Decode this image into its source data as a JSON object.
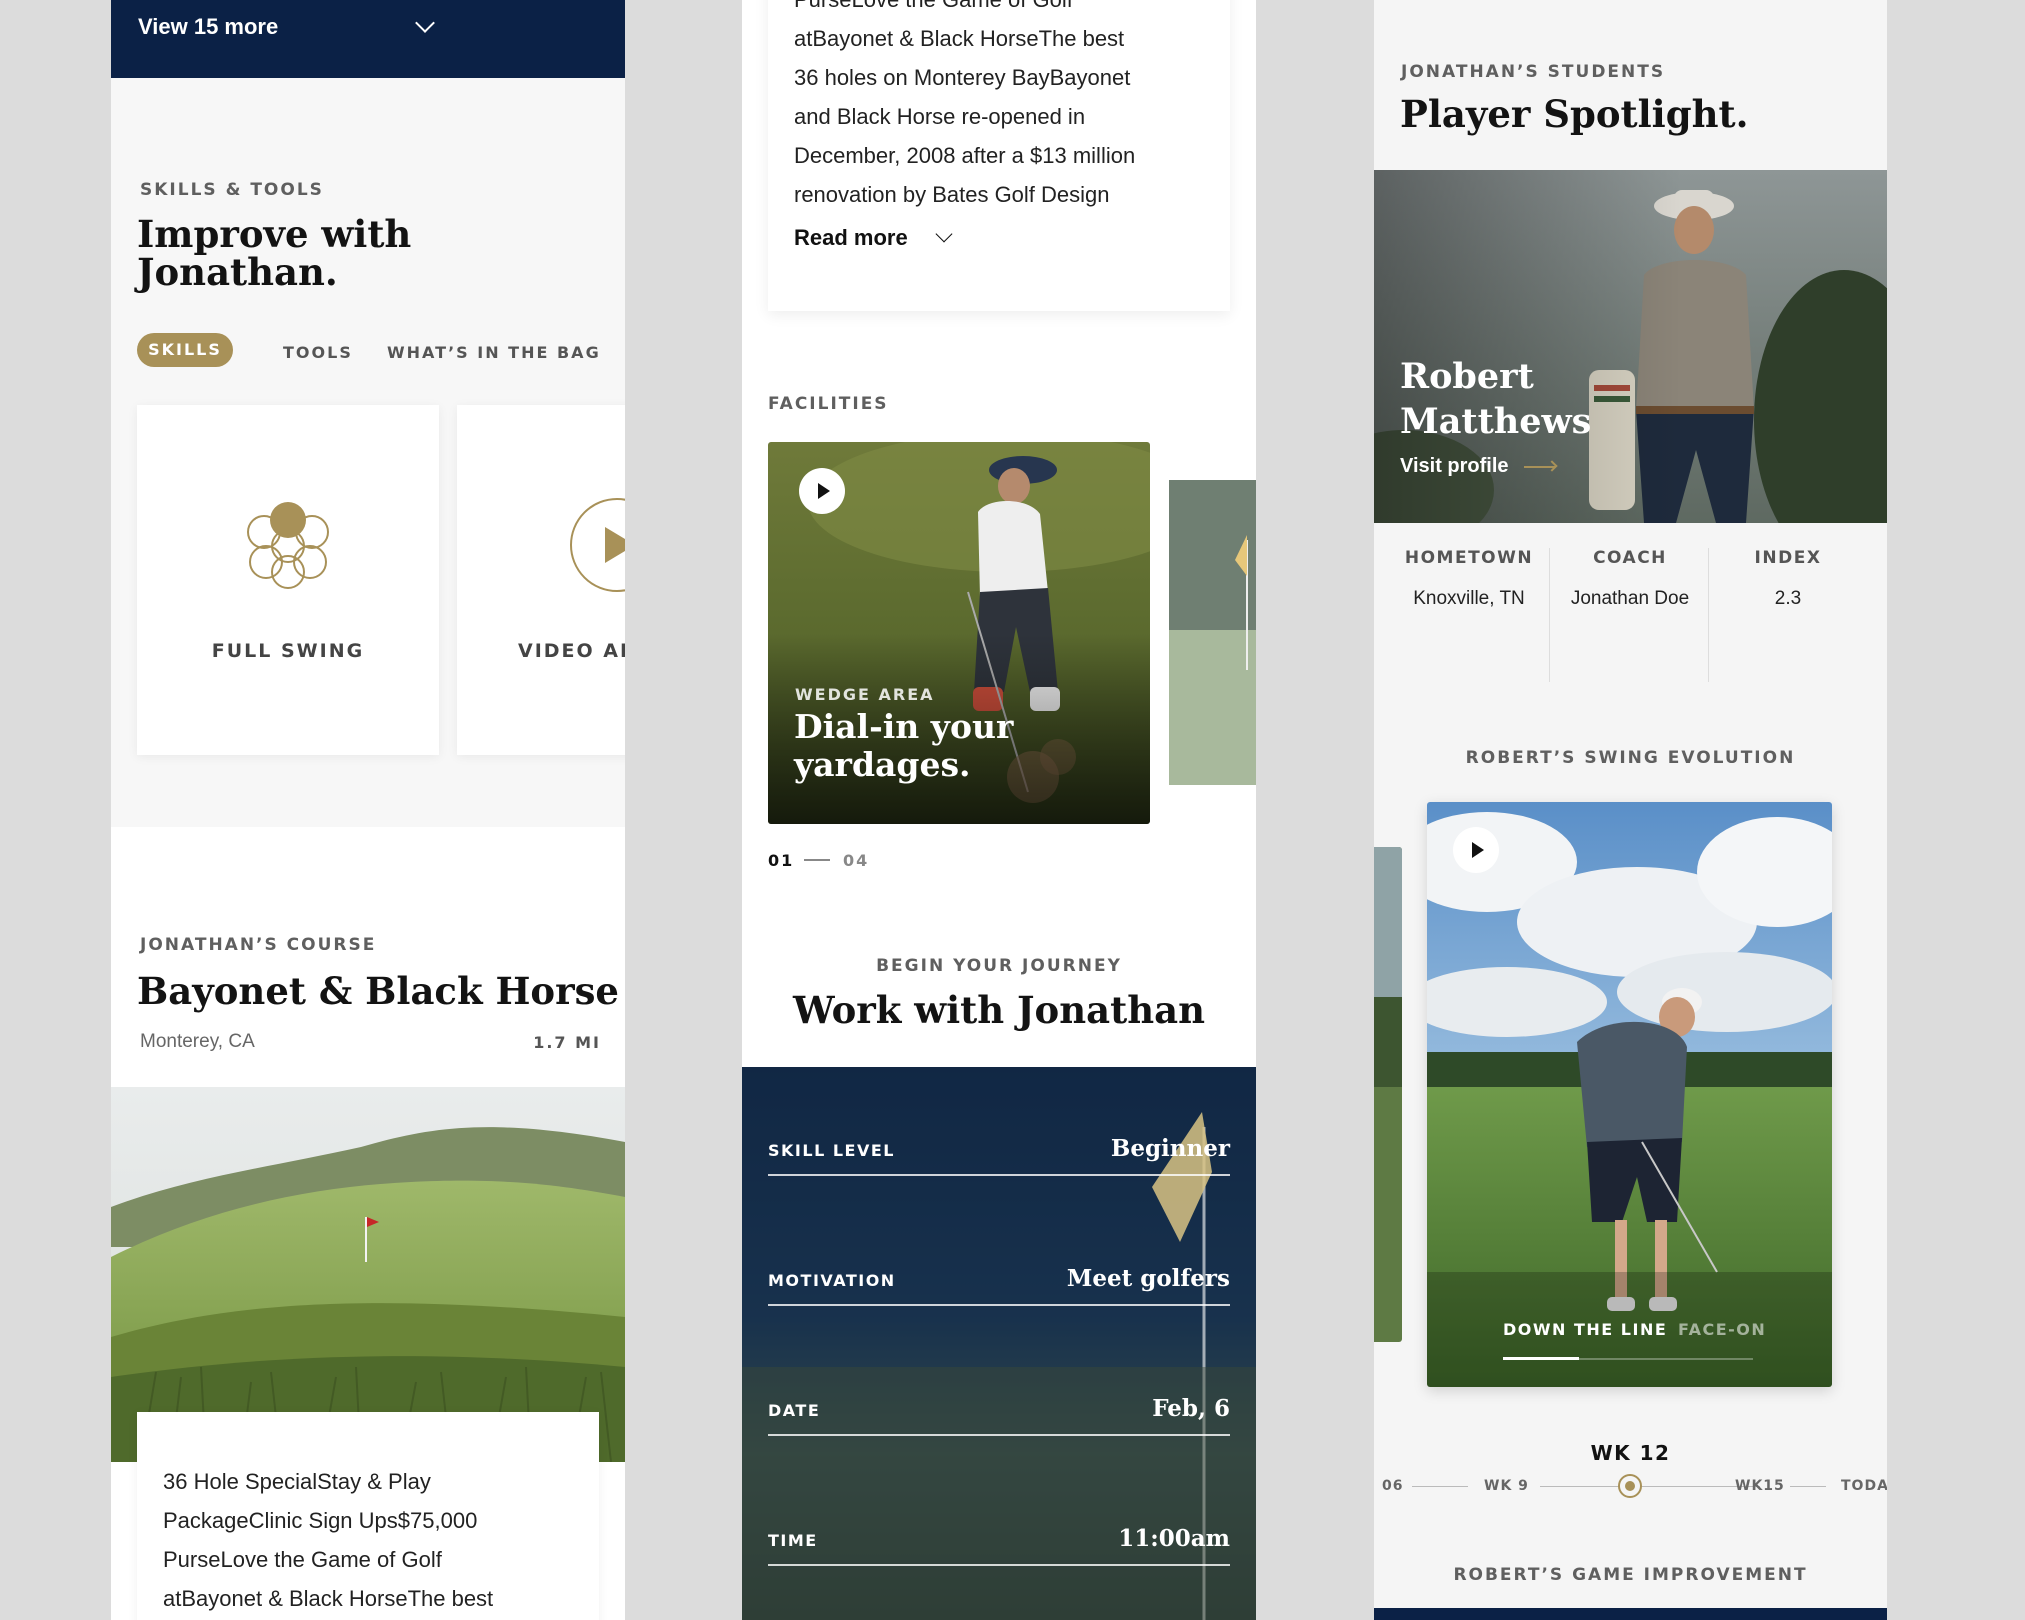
{
  "col1": {
    "view_more": "View 15 more",
    "skills_eyebrow": "SKILLS & TOOLS",
    "skills_title_1": "Improve with",
    "skills_title_2": "Jonathan.",
    "tabs": [
      "SKILLS",
      "TOOLS",
      "WHAT’S IN THE BAG"
    ],
    "cards": [
      "FULL SWING",
      "VIDEO AN"
    ],
    "course_eyebrow": "JONATHAN’S COURSE",
    "course_title": "Bayonet & Black Horse",
    "course_location": "Monterey, CA",
    "course_distance": "1.7 MI",
    "promo_lines": [
      "36 Hole SpecialStay & Play",
      "PackageClinic Sign Ups$75,000",
      "PurseLove the Game of Golf",
      "atBayonet & Black HorseThe best"
    ]
  },
  "col2": {
    "about_lines": [
      "PurseLove the Game of Golf",
      "atBayonet & Black HorseThe best",
      "36 holes on Monterey BayBayonet",
      "and Black Horse re-opened in",
      "December, 2008 after a $13 million",
      "renovation by Bates Golf Design"
    ],
    "read_more": "Read more",
    "facilities_eyebrow": "FACILITIES",
    "facility_eyebrow": "WEDGE AREA",
    "facility_title_1": "Dial-in your",
    "facility_title_2": "yardages.",
    "pager_current": "01",
    "pager_total": "04",
    "journey_eyebrow": "BEGIN YOUR JOURNEY",
    "journey_title": "Work with Jonathan",
    "form": [
      {
        "label": "SKILL LEVEL",
        "value": "Beginner"
      },
      {
        "label": "MOTIVATION",
        "value": "Meet golfers"
      },
      {
        "label": "DATE",
        "value": "Feb, 6"
      },
      {
        "label": "TIME",
        "value": "11:00am"
      }
    ]
  },
  "col3": {
    "eyebrow": "JONATHAN’S STUDENTS",
    "title": "Player Spotlight.",
    "player_name_1": "Robert",
    "player_name_2": "Matthews",
    "visit_profile": "Visit profile",
    "stats": [
      {
        "label": "HOMETOWN",
        "value": "Knoxville, TN"
      },
      {
        "label": "COACH",
        "value": "Jonathan Doe"
      },
      {
        "label": "INDEX",
        "value": "2.3"
      }
    ],
    "swing_eyebrow": "ROBERT’S SWING EVOLUTION",
    "swing_tabs": [
      "DOWN THE LINE",
      "FACE-ON"
    ],
    "timeline_current": "WK 12",
    "timeline_labels": [
      "06",
      "WK 9",
      "WK15",
      "TODAY"
    ],
    "game_eyebrow": "ROBERT’S GAME IMPROVEMENT"
  },
  "colors": {
    "navy": "#0b2146",
    "gold": "#a89158"
  }
}
